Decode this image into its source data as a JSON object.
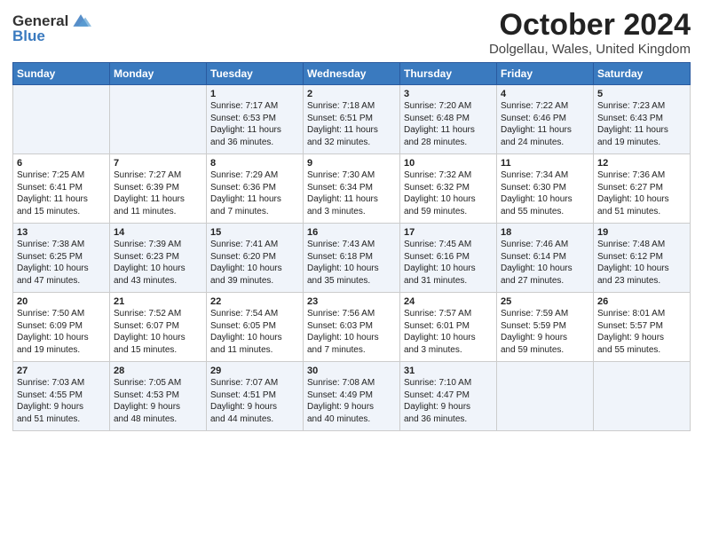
{
  "logo": {
    "general": "General",
    "blue": "Blue"
  },
  "title": "October 2024",
  "location": "Dolgellau, Wales, United Kingdom",
  "headers": [
    "Sunday",
    "Monday",
    "Tuesday",
    "Wednesday",
    "Thursday",
    "Friday",
    "Saturday"
  ],
  "weeks": [
    [
      {
        "day": "",
        "info": ""
      },
      {
        "day": "",
        "info": ""
      },
      {
        "day": "1",
        "info": "Sunrise: 7:17 AM\nSunset: 6:53 PM\nDaylight: 11 hours\nand 36 minutes."
      },
      {
        "day": "2",
        "info": "Sunrise: 7:18 AM\nSunset: 6:51 PM\nDaylight: 11 hours\nand 32 minutes."
      },
      {
        "day": "3",
        "info": "Sunrise: 7:20 AM\nSunset: 6:48 PM\nDaylight: 11 hours\nand 28 minutes."
      },
      {
        "day": "4",
        "info": "Sunrise: 7:22 AM\nSunset: 6:46 PM\nDaylight: 11 hours\nand 24 minutes."
      },
      {
        "day": "5",
        "info": "Sunrise: 7:23 AM\nSunset: 6:43 PM\nDaylight: 11 hours\nand 19 minutes."
      }
    ],
    [
      {
        "day": "6",
        "info": "Sunrise: 7:25 AM\nSunset: 6:41 PM\nDaylight: 11 hours\nand 15 minutes."
      },
      {
        "day": "7",
        "info": "Sunrise: 7:27 AM\nSunset: 6:39 PM\nDaylight: 11 hours\nand 11 minutes."
      },
      {
        "day": "8",
        "info": "Sunrise: 7:29 AM\nSunset: 6:36 PM\nDaylight: 11 hours\nand 7 minutes."
      },
      {
        "day": "9",
        "info": "Sunrise: 7:30 AM\nSunset: 6:34 PM\nDaylight: 11 hours\nand 3 minutes."
      },
      {
        "day": "10",
        "info": "Sunrise: 7:32 AM\nSunset: 6:32 PM\nDaylight: 10 hours\nand 59 minutes."
      },
      {
        "day": "11",
        "info": "Sunrise: 7:34 AM\nSunset: 6:30 PM\nDaylight: 10 hours\nand 55 minutes."
      },
      {
        "day": "12",
        "info": "Sunrise: 7:36 AM\nSunset: 6:27 PM\nDaylight: 10 hours\nand 51 minutes."
      }
    ],
    [
      {
        "day": "13",
        "info": "Sunrise: 7:38 AM\nSunset: 6:25 PM\nDaylight: 10 hours\nand 47 minutes."
      },
      {
        "day": "14",
        "info": "Sunrise: 7:39 AM\nSunset: 6:23 PM\nDaylight: 10 hours\nand 43 minutes."
      },
      {
        "day": "15",
        "info": "Sunrise: 7:41 AM\nSunset: 6:20 PM\nDaylight: 10 hours\nand 39 minutes."
      },
      {
        "day": "16",
        "info": "Sunrise: 7:43 AM\nSunset: 6:18 PM\nDaylight: 10 hours\nand 35 minutes."
      },
      {
        "day": "17",
        "info": "Sunrise: 7:45 AM\nSunset: 6:16 PM\nDaylight: 10 hours\nand 31 minutes."
      },
      {
        "day": "18",
        "info": "Sunrise: 7:46 AM\nSunset: 6:14 PM\nDaylight: 10 hours\nand 27 minutes."
      },
      {
        "day": "19",
        "info": "Sunrise: 7:48 AM\nSunset: 6:12 PM\nDaylight: 10 hours\nand 23 minutes."
      }
    ],
    [
      {
        "day": "20",
        "info": "Sunrise: 7:50 AM\nSunset: 6:09 PM\nDaylight: 10 hours\nand 19 minutes."
      },
      {
        "day": "21",
        "info": "Sunrise: 7:52 AM\nSunset: 6:07 PM\nDaylight: 10 hours\nand 15 minutes."
      },
      {
        "day": "22",
        "info": "Sunrise: 7:54 AM\nSunset: 6:05 PM\nDaylight: 10 hours\nand 11 minutes."
      },
      {
        "day": "23",
        "info": "Sunrise: 7:56 AM\nSunset: 6:03 PM\nDaylight: 10 hours\nand 7 minutes."
      },
      {
        "day": "24",
        "info": "Sunrise: 7:57 AM\nSunset: 6:01 PM\nDaylight: 10 hours\nand 3 minutes."
      },
      {
        "day": "25",
        "info": "Sunrise: 7:59 AM\nSunset: 5:59 PM\nDaylight: 9 hours\nand 59 minutes."
      },
      {
        "day": "26",
        "info": "Sunrise: 8:01 AM\nSunset: 5:57 PM\nDaylight: 9 hours\nand 55 minutes."
      }
    ],
    [
      {
        "day": "27",
        "info": "Sunrise: 7:03 AM\nSunset: 4:55 PM\nDaylight: 9 hours\nand 51 minutes."
      },
      {
        "day": "28",
        "info": "Sunrise: 7:05 AM\nSunset: 4:53 PM\nDaylight: 9 hours\nand 48 minutes."
      },
      {
        "day": "29",
        "info": "Sunrise: 7:07 AM\nSunset: 4:51 PM\nDaylight: 9 hours\nand 44 minutes."
      },
      {
        "day": "30",
        "info": "Sunrise: 7:08 AM\nSunset: 4:49 PM\nDaylight: 9 hours\nand 40 minutes."
      },
      {
        "day": "31",
        "info": "Sunrise: 7:10 AM\nSunset: 4:47 PM\nDaylight: 9 hours\nand 36 minutes."
      },
      {
        "day": "",
        "info": ""
      },
      {
        "day": "",
        "info": ""
      }
    ]
  ]
}
